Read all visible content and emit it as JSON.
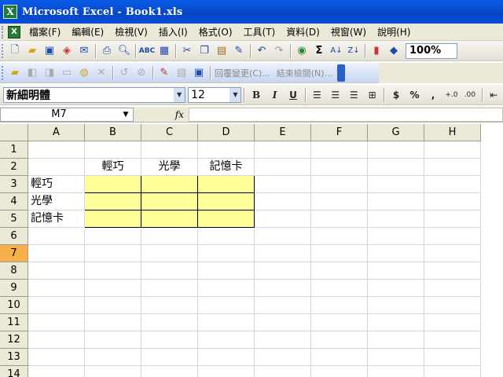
{
  "window": {
    "title": "Microsoft Excel - Book1.xls",
    "app_icon": "excel-icon"
  },
  "menu": [
    "檔案(F)",
    "編輯(E)",
    "檢視(V)",
    "插入(I)",
    "格式(O)",
    "工具(T)",
    "資料(D)",
    "視窗(W)",
    "說明(H)"
  ],
  "standard_toolbar": {
    "zoom": "100%",
    "buttons": [
      "new-icon",
      "open-icon",
      "save-icon",
      "permission-icon",
      "email-icon",
      "print-icon",
      "print-preview-icon",
      "spelling-icon",
      "research-icon",
      "cut-icon",
      "copy-icon",
      "paste-icon",
      "format-painter-icon",
      "undo-icon",
      "redo-icon",
      "hyperlink-icon",
      "autosum-icon",
      "sort-asc-icon",
      "sort-desc-icon",
      "chart-wizard-icon",
      "drawing-icon"
    ]
  },
  "review_toolbar": {
    "reply_label": "回覆變更(C)...",
    "end_review_label": "結束檢閱(N)..."
  },
  "formatting_toolbar": {
    "font": "新細明體",
    "size": "12",
    "buttons": [
      "B",
      "I",
      "U"
    ]
  },
  "formula_bar": {
    "name_box": "M7",
    "fx": "fx",
    "content": ""
  },
  "sheet": {
    "columns": [
      "A",
      "B",
      "C",
      "D",
      "E",
      "F",
      "G",
      "H"
    ],
    "rows": [
      "1",
      "2",
      "3",
      "4",
      "5",
      "6",
      "7",
      "8",
      "9",
      "10",
      "11",
      "12",
      "13",
      "14"
    ],
    "active_row": "7",
    "cells": {
      "B2": "輕巧",
      "C2": "光學",
      "D2": "記憶卡",
      "A3": "輕巧",
      "A4": "光學",
      "A5": "記憶卡"
    }
  },
  "colors": {
    "highlight": "#ffff99",
    "active_header": "#f7b14a",
    "title_bar": "#0a5ce8"
  }
}
